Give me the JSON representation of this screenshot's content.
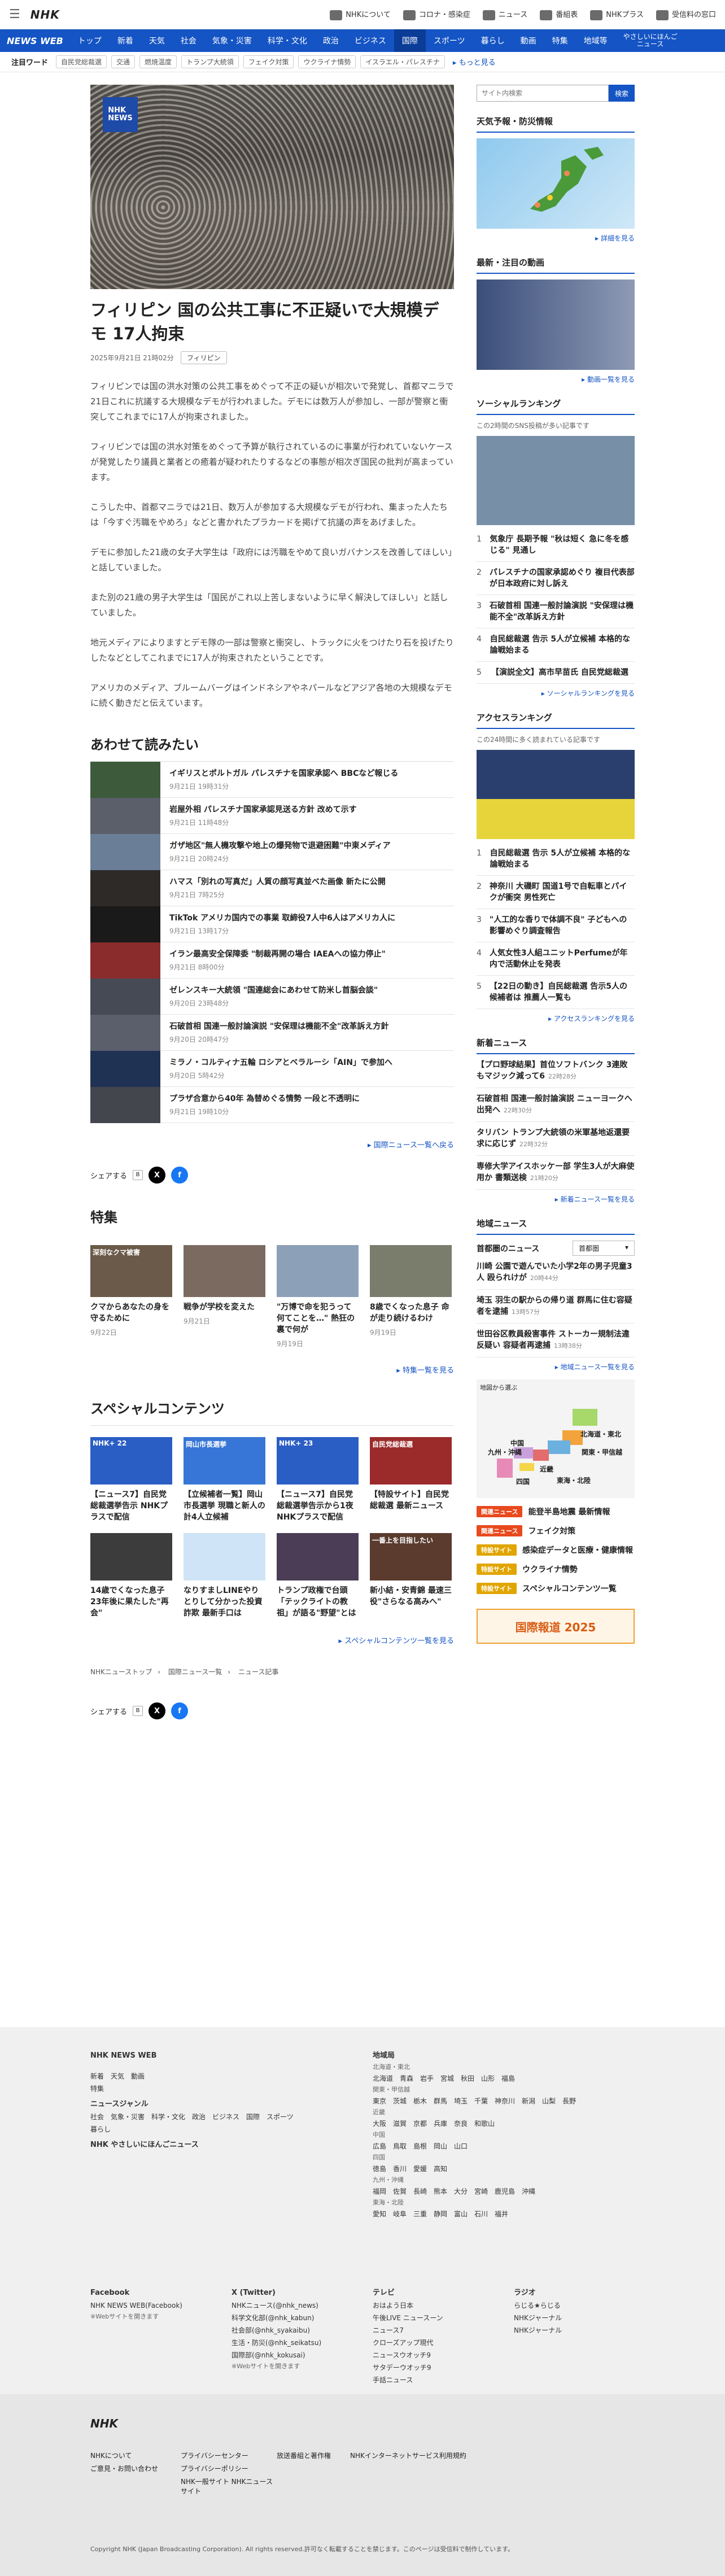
{
  "top": {
    "logo": "NHK",
    "links": [
      "NHKについて",
      "コロナ・感染症",
      "ニュース",
      "番組表",
      "NHKプラス",
      "受信料の窓口"
    ]
  },
  "nav": {
    "brand": "NEWS WEB",
    "items": [
      "トップ",
      "新着",
      "天気",
      "社会",
      "気象・災害",
      "科学・文化",
      "政治",
      "ビジネス",
      "国際",
      "スポーツ",
      "暮らし",
      "動画",
      "特集",
      "地域等",
      "やさしいにほんご\nニュース"
    ],
    "active": "国際"
  },
  "hot": {
    "label": "注目ワード",
    "chips": [
      "自民党総裁選",
      "交通",
      "燃焼温度",
      "トランプ大統領",
      "フェイク対策",
      "ウクライナ情勢",
      "イスラエル・パレスチナ"
    ],
    "more": "もっと見る"
  },
  "article": {
    "hero_badge": "NHK\nNEWS",
    "title": "フィリピン 国の公共工事に不正疑いで大規模デモ 17人拘束",
    "date": "2025年9月21日 21時02分",
    "tag": "フィリピン",
    "paragraphs": [
      "フィリピンでは国の洪水対策の公共工事をめぐって不正の疑いが相次いで発覚し、首都マニラで21日これに抗議する大規模なデモが行われました。デモには数万人が参加し、一部が警察と衝突してこれまでに17人が拘束されました。",
      "フィリピンでは国の洪水対策をめぐって予算が執行されているのに事業が行われていないケースが発覚したり議員と業者との癒着が疑われたりするなどの事態が相次ぎ国民の批判が高まっています。",
      "こうした中、首都マニラでは21日、数万人が参加する大規模なデモが行われ、集まった人たちは「今すぐ汚職をやめろ」などと書かれたプラカードを掲げて抗議の声をあげました。",
      "デモに参加した21歳の女子大学生は「政府には汚職をやめて良いガバナンスを改善してほしい」と話していました。",
      "また別の21歳の男子大学生は「国民がこれ以上苦しまないように早く解決してほしい」と話していました。",
      "地元メディアによりますとデモ隊の一部は警察と衝突し、トラックに火をつけたり石を投げたりしたなどとしてこれまでに17人が拘束されたということです。",
      "アメリカのメディア、ブルームバーグはインドネシアやネパールなどアジア各地の大規模なデモに続く動きだと伝えています。"
    ]
  },
  "related": {
    "heading": "あわせて読みたい",
    "items": [
      {
        "title": "イギリスとポルトガル パレスチナを国家承認へ BBCなど報じる",
        "date": "9月21日 19時31分"
      },
      {
        "title": "岩屋外相 パレスチナ国家承認見送る方針 改めて示す",
        "date": "9月21日 11時48分"
      },
      {
        "title": "ガザ地区\"無人機攻撃や地上の爆発物で退避困難\"中東メディア",
        "date": "9月21日 20時24分"
      },
      {
        "title": "ハマス「別れの写真だ」人質の顔写真並べた画像 新たに公開",
        "date": "9月21日 7時25分"
      },
      {
        "title": "TikTok アメリカ国内での事業 取締役7人中6人はアメリカ人に",
        "date": "9月21日 13時17分"
      },
      {
        "title": "イラン最高安全保障委 \"制裁再開の場合 IAEAへの協力停止\"",
        "date": "9月21日 8時00分"
      },
      {
        "title": "ゼレンスキー大統領 \"国連総会にあわせて防米し首脳会談\"",
        "date": "9月20日 23時48分"
      },
      {
        "title": "石破首相 国連一般討論演説 \"安保理は機能不全\"改革訴え方針",
        "date": "9月20日 20時47分"
      },
      {
        "title": "ミラノ・コルティナ五輪 ロシアとベラルーシ「AIN」で参加へ",
        "date": "9月20日 5時42分"
      },
      {
        "title": "プラザ合意から40年 為替めぐる情勢 一段と不透明に",
        "date": "9月21日 19時10分"
      }
    ],
    "more": "国際ニュース一覧へ戻る"
  },
  "share": {
    "label": "シェアする"
  },
  "features": {
    "heading": "特集",
    "items": [
      {
        "title": "クマからあなたの身を守るために",
        "date": "9月22日",
        "img": "深刻なクマ被害"
      },
      {
        "title": "戦争が学校を変えた",
        "date": "9月21日",
        "img": ""
      },
      {
        "title": "\"万博で命を犯うって何てことを…\" 熱狂の裏で何が",
        "date": "9月19日",
        "img": ""
      },
      {
        "title": "8歳でくなった息子 命が走り続けるわけ",
        "date": "9月19日",
        "img": ""
      }
    ],
    "more": "特集一覧を見る"
  },
  "special": {
    "heading": "スペシャルコンテンツ",
    "items": [
      {
        "title": "【ニュース7】自民党総裁選挙告示 NHKプラスで配信",
        "img": "NHK+ 22"
      },
      {
        "title": "【立候補者一覧】岡山市長選挙 現職と新人の計4人立候補",
        "img": "岡山市長選挙"
      },
      {
        "title": "【ニュース7】自民党 総裁選挙告示から1夜 NHKプラスで配信",
        "img": "NHK+ 23"
      },
      {
        "title": "【特設サイト】自民党総裁選 最新ニュース",
        "img": "自民党総裁選"
      },
      {
        "title": "14歳でくなった息子 23年後に果たした\"再会\"",
        "img": ""
      },
      {
        "title": "なりすましLINEやりとりして分かった投資詐欺 最新手口は",
        "img": ""
      },
      {
        "title": "トランプ政権で台頭「テックライトの教祖」が語る\"野望\"とは",
        "img": ""
      },
      {
        "title": "新小結・安青錦 最速三役\"さらなる高みへ\"",
        "img": "一番上を目指したい"
      }
    ],
    "more": "スペシャルコンテンツ一覧を見る"
  },
  "crumbs": [
    "NHKニューストップ",
    "国際ニュース一覧",
    "ニュース記事"
  ],
  "side": {
    "search_placeholder": "サイト内検索",
    "search_btn": "検索",
    "weather_h": "天気予報・防災情報",
    "weather_more": "詳細を見る",
    "video_h": "最新・注目の動画",
    "video_more": "動画一覧を見る",
    "social_h": "ソーシャルランキング",
    "social_sub": "この2時間のSNS投稿が多い記事です",
    "social_items": [
      "気象庁 長期予報 \"秋は短く 急に冬を感じる\" 見通し",
      "パレスチナの国家承認めぐり 複目代表部が日本政府に対し訴え",
      "石破首相 国連一般討論演説 \"安保理は機能不全\"改革訴え方針",
      "自民総裁選 告示 5人が立候補 本格的な論戦始まる",
      "【演説全文】高市早苗氏 自民党総裁選"
    ],
    "social_more": "ソーシャルランキングを見る",
    "access_h": "アクセスランキング",
    "access_sub": "この24時間に多く読まれている記事です",
    "access_items": [
      "自民総裁選 告示 5人が立候補 本格的な論戦始まる",
      "神奈川 大磯町 国道1号で自転車とパイクが衝突 男性死亡",
      "\"人工的な香りで体調不良\" 子どもへの影響めぐり調査報告",
      "人気女性3人組ユニットPerfumeが年内で活動休止を発表",
      "【22日の動き】自民総裁選 告示5人の候補者は 推薦人一覧も"
    ],
    "access_more": "アクセスランキングを見る",
    "new_h": "新着ニュース",
    "new_items": [
      {
        "t": "【プロ野球結果】首位ソフトバンク 3連敗もマジック減って6",
        "d": "22時28分"
      },
      {
        "t": "石破首相 国連一般討論演説 ニューヨークへ 出発へ",
        "d": "22時30分"
      },
      {
        "t": "タリバン トランプ大統領の米軍基地返還要求に応じず",
        "d": "22時32分"
      },
      {
        "t": "専修大学アイスホッケー部 学生3人が大麻使用か 書類送検",
        "d": "21時20分"
      }
    ],
    "new_more": "新着ニュース一覧を見る",
    "region_h": "地域ニュース",
    "region_label": "首都圏のニュース",
    "region_sel": "首都圏",
    "region_items": [
      {
        "t": "川崎 公園で遊んでいた小学2年の男子児童3人 殴られけが",
        "d": "20時44分"
      },
      {
        "t": "埼玉 羽生の駅からの帰り道 群馬に住む容疑者を逮捕",
        "d": "13時57分"
      },
      {
        "t": "世田谷区教員殺害事件 ストーカー規制法違反疑い 容疑者再逮捕",
        "d": "13時38分"
      }
    ],
    "region_more": "地域ニュース一覧を見る",
    "map_caption": "地図から選ぶ",
    "map_labels": [
      "北海道・東北",
      "関東・甲信越",
      "東海・北陸",
      "近畿",
      "中国",
      "四国",
      "九州・沖縄"
    ],
    "tagged": [
      {
        "lb": "関連ニュース",
        "t": "能登半島地震 最新情報",
        "y": false
      },
      {
        "lb": "関連ニュース",
        "t": "フェイク対策",
        "y": false
      },
      {
        "lb": "特設サイト",
        "t": "感染症データと医療・健康情報",
        "y": true
      },
      {
        "lb": "特設サイト",
        "t": "ウクライナ情勢",
        "y": true
      },
      {
        "lb": "特設サイト",
        "t": "スペシャルコンテンツ一覧",
        "y": true
      }
    ],
    "banner": "国際報道 2025"
  },
  "footer": {
    "brand": "NHK NEWS WEB",
    "nav1": "新着　天気　動画",
    "nav2": "特集",
    "genre_h": "ニュースジャンル",
    "genre": "社会　気象・災害　科学・文化　政治　ビジネス　国際　スポーツ",
    "genre2": "暮らし",
    "easy": "NHK やさしいにほんごニュース",
    "region_h": "地域局",
    "regions": [
      "北海道・東北",
      "北海道　青森　岩手　宮城　秋田　山形　福島",
      "関東・甲信越",
      "東京　茨城　栃木　群馬　埼玉　千葉　神奈川　新潟　山梨　長野",
      "近畿",
      "大阪　滋賀　京都　兵庫　奈良　和歌山",
      "中国",
      "広島　鳥取　島根　岡山　山口",
      "四国",
      "徳島　香川　愛媛　高知",
      "九州・沖縄",
      "福岡　佐賀　長崎　熊本　大分　宮崎　鹿児島　沖縄",
      "東海・北陸",
      "愛知　岐阜　三重　静岡　富山　石川　福井"
    ],
    "fb_h": "Facebook",
    "fb": [
      "NHK NEWS WEB(Facebook)",
      "※Webサイトを開きます"
    ],
    "x_h": "X (Twitter)",
    "x": [
      "NHKニュース(@nhk_news)",
      "科学文化部(@nhk_kabun)",
      "社会部(@nhk_syakaibu)",
      "生活・防災(@nhk_seikatsu)",
      "国際部(@nhk_kokusai)",
      "※Webサイトを開きます"
    ],
    "tv_h": "テレビ",
    "tv": [
      "おはよう日本",
      "午後LIVE ニュースーン",
      "ニュース7",
      "クローズアップ現代",
      "ニュースウオッチ9",
      "サタデーウオッチ9",
      "手話ニュース"
    ],
    "radio_h": "ラジオ",
    "radio": [
      "らじる★らじる",
      "NHKジャーナル",
      "NHKジャーナル"
    ],
    "bottom_logo": "NHK",
    "bottom_links": [
      "NHKについて",
      "ご意見・お問い合わせ",
      "プライバシーセンター",
      "プライバシーポリシー",
      "NHK一般サイト NHKニュースサイト",
      "放送番組と著作権",
      "NHKインターネットサービス利用規約"
    ],
    "copyright": "Copyright NHK (Japan Broadcasting Corporation). All rights reserved.許可なく転載することを禁じます。このページは受信料で制作しています。"
  }
}
